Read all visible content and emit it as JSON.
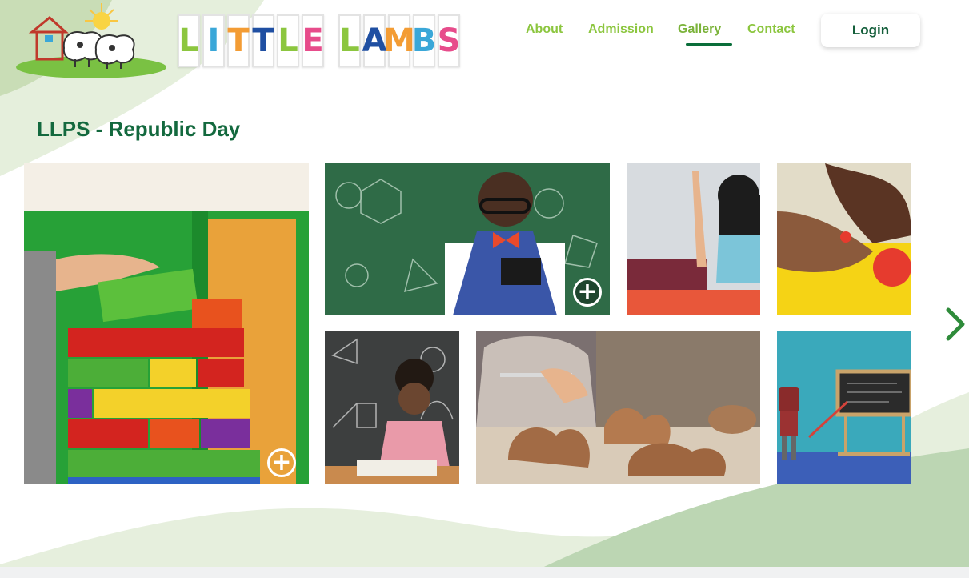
{
  "brand": {
    "letters": [
      "L",
      "I",
      "T",
      "T",
      "L",
      "E",
      " ",
      "L",
      "A",
      "M",
      "B",
      "S"
    ],
    "letter_colors": [
      "#8cc63f",
      "#3aa7d8",
      "#f39c34",
      "#1f4fa2",
      "#8cc63f",
      "#e74c8b",
      "",
      "#8cc63f",
      "#1f4fa2",
      "#f39c34",
      "#3aa7d8",
      "#e74c8b"
    ]
  },
  "nav": {
    "items": [
      {
        "label": "About"
      },
      {
        "label": "Admission"
      },
      {
        "label": "Gallery",
        "active": true
      },
      {
        "label": "Contact"
      }
    ],
    "login_label": "Login"
  },
  "page": {
    "title": "LLPS - Republic Day"
  },
  "gallery": {
    "expand_icon": "plus-circle-icon",
    "next_icon": "chevron-right-icon",
    "images": [
      {
        "subject": "wooden-blocks"
      },
      {
        "subject": "boy-chalkboard"
      },
      {
        "subject": "girl-craft"
      },
      {
        "subject": "clay-hands"
      },
      {
        "subject": "girl-math-board"
      },
      {
        "subject": "clay-animals"
      },
      {
        "subject": "robot-board"
      }
    ]
  },
  "colors": {
    "accent_green": "#8cc63f",
    "title_green": "#13693e",
    "underline": "#0a6e3a"
  }
}
